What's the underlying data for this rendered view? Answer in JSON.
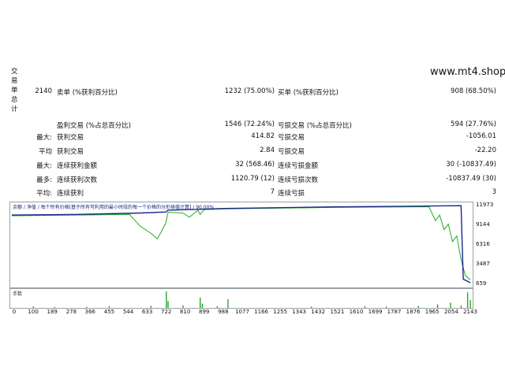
{
  "site": "www.mt4.shop",
  "side_label": [
    "交",
    "易",
    "单",
    "总",
    "计"
  ],
  "rows": [
    {
      "c1": "2140",
      "c2": "卖单 (%获利百分比)",
      "c3": "1232 (75.00%)",
      "c4": "买单 (%获利百分比)",
      "c5": "908 (68.50%)"
    },
    {
      "c1": "",
      "c2": "盈利交易 (%占总百分比)",
      "c3": "1546 (72.24%)",
      "c4": "亏损交易 (%占总百分比)",
      "c5": "594 (27.76%)"
    },
    {
      "c1": "最大:",
      "c2": "获利交易",
      "c3": "414.82",
      "c4": "亏损交易",
      "c5": "-1056.01"
    },
    {
      "c1": "平均",
      "c2": "获利交易",
      "c3": "2.84",
      "c4": "亏损交易",
      "c5": "-22.20"
    },
    {
      "c1": "最大:",
      "c2": "连续获利金额",
      "c3": "32 (568.46)",
      "c4": "连续亏损金额",
      "c5": "30 (-10837.49)"
    },
    {
      "c1": "最多:",
      "c2": "连续获利次数",
      "c3": "1120.79 (12)",
      "c4": "连续亏损次数",
      "c5": "-10837.49 (30)"
    },
    {
      "c1": "平均:",
      "c2": "连续获利",
      "c3": "7",
      "c4": "连续亏损",
      "c5": "3"
    }
  ],
  "chart_legend": "余额 / 净值 / 每个所有价格[基于所有可利用的最小时段的每一个价格的分形插值计算] / 90.00%",
  "volume_legend": "手数",
  "chart_data": {
    "type": "line",
    "title": "",
    "y_ticks": [
      "11973",
      "9144",
      "6316",
      "3487",
      "659"
    ],
    "x_ticks": [
      "0",
      "100",
      "189",
      "278",
      "366",
      "455",
      "544",
      "633",
      "722",
      "810",
      "899",
      "988",
      "1077",
      "1166",
      "1255",
      "1343",
      "1432",
      "1521",
      "1610",
      "1699",
      "1787",
      "1876",
      "1965",
      "2054",
      "2143"
    ],
    "ylim": [
      659,
      11973
    ],
    "xlim": [
      0,
      2143
    ],
    "series": [
      {
        "name": "余额",
        "color": "#1a2a8a",
        "x": [
          0,
          300,
          600,
          720,
          730,
          900,
          1000,
          1200,
          1500,
          1800,
          2000,
          2100,
          2110,
          2143
        ],
        "y": [
          10600,
          10700,
          10900,
          11050,
          11300,
          11450,
          11550,
          11650,
          11780,
          11850,
          11930,
          11950,
          1400,
          900
        ]
      },
      {
        "name": "净值",
        "color": "#22aa22",
        "x": [
          0,
          300,
          550,
          600,
          650,
          680,
          700,
          720,
          730,
          800,
          830,
          850,
          870,
          880,
          900,
          1000,
          1500,
          1950,
          1980,
          2000,
          2020,
          2040,
          2060,
          2080,
          2100,
          2120,
          2143
        ],
        "y": [
          10500,
          10600,
          10700,
          9000,
          8000,
          7200,
          8300,
          9500,
          11000,
          10900,
          10300,
          10800,
          11300,
          10700,
          11400,
          11500,
          11700,
          11800,
          9800,
          10600,
          8500,
          9300,
          6800,
          7600,
          4200,
          1900,
          1300
        ]
      }
    ],
    "volume": {
      "color": "#22aa22",
      "x": [
        100,
        200,
        350,
        455,
        650,
        722,
        730,
        800,
        880,
        890,
        960,
        1010,
        1400,
        1650,
        1750,
        1900,
        1990,
        2050,
        2100,
        2130,
        2143
      ],
      "y": [
        0.08,
        0.05,
        0.06,
        0.1,
        0.12,
        0.95,
        0.4,
        0.15,
        0.6,
        0.25,
        0.1,
        0.5,
        0.08,
        0.1,
        0.08,
        0.12,
        0.2,
        0.3,
        0.15,
        0.9,
        0.45
      ]
    }
  }
}
